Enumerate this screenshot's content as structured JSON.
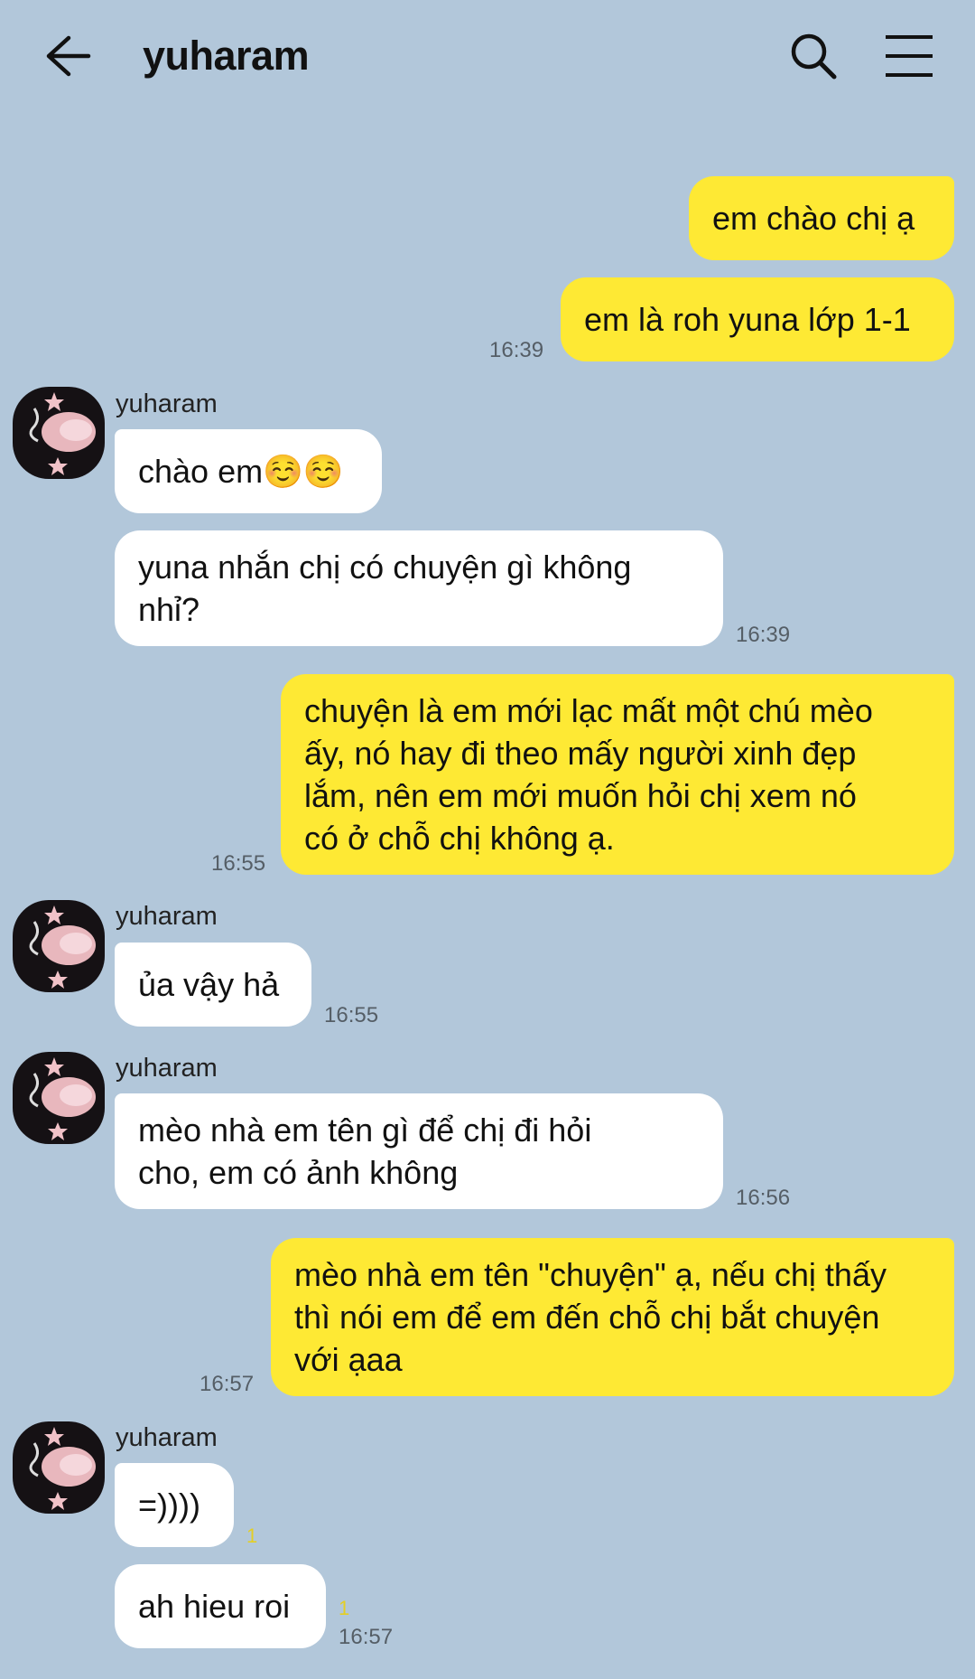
{
  "header": {
    "title": "yuharam",
    "back_icon": "arrow-left-icon",
    "search_icon": "search-icon",
    "menu_icon": "hamburger-menu-icon"
  },
  "colors": {
    "background": "#b2c7da",
    "my_bubble": "#fee934",
    "their_bubble": "#ffffff",
    "unread": "#e4cf24"
  },
  "messages": [
    {
      "from": "me",
      "text": "em chào chị ạ"
    },
    {
      "from": "me",
      "text": "em là roh yuna lớp 1-1",
      "time": "16:39"
    },
    {
      "from": "yuharam",
      "sender": "yuharam",
      "text": "chào em☺️☺️"
    },
    {
      "from": "yuharam",
      "text": "yuna nhắn chị có chuyện gì không\nnhỉ?",
      "time": "16:39"
    },
    {
      "from": "me",
      "text": "chuyện là em mới lạc mất một chú mèo\nấy, nó hay đi theo mấy người xinh đẹp\nlắm, nên em mới muốn hỏi chị xem nó\ncó ở chỗ chị không ạ.",
      "time": "16:55"
    },
    {
      "from": "yuharam",
      "sender": "yuharam",
      "text": "ủa vậy hả",
      "time": "16:55"
    },
    {
      "from": "yuharam",
      "sender": "yuharam",
      "text": "mèo nhà em tên gì để chị đi hỏi\ncho, em có ảnh không",
      "time": "16:56"
    },
    {
      "from": "me",
      "text": "mèo nhà em tên \"chuyện\" ạ, nếu chị thấy\nthì nói em để em đến chỗ chị bắt chuyện\nvới ạaa",
      "time": "16:57"
    },
    {
      "from": "yuharam",
      "sender": "yuharam",
      "text": "=))))",
      "unread": "1"
    },
    {
      "from": "yuharam",
      "text": "ah hieu roi",
      "unread": "1",
      "time": "16:57"
    }
  ]
}
